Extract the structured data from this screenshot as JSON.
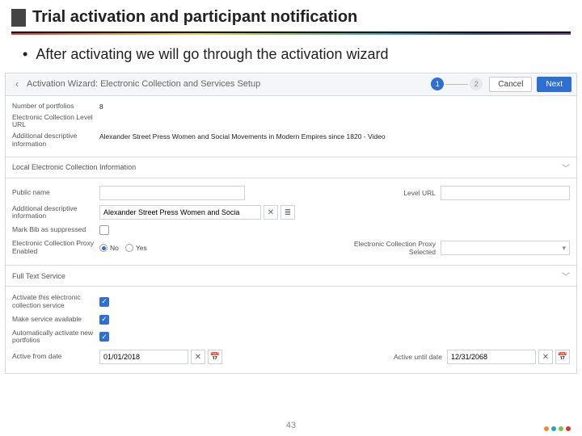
{
  "slide": {
    "title": "Trial activation and participant notification",
    "bullet": "After activating we will go through the activation wizard",
    "page_number": "43"
  },
  "wizard": {
    "back_glyph": "‹",
    "title": "Activation Wizard: Electronic Collection and Services Setup",
    "step_current": "1",
    "step_next": "2",
    "cancel": "Cancel",
    "next": "Next"
  },
  "summary": {
    "num_portfolios_label": "Number of portfolios",
    "num_portfolios_value": "8",
    "ec_url_label": "Electronic Collection Level URL",
    "ec_url_value": "",
    "addl_label": "Additional descriptive information",
    "addl_value": "Alexander Street Press Women and Social Movements in Modern Empires since 1820 - Video"
  },
  "sections": {
    "local_info": "Local Electronic Collection Information",
    "full_text": "Full Text Service"
  },
  "local": {
    "public_name_label": "Public name",
    "public_name_value": "",
    "level_url_label": "Level URL",
    "level_url_value": "",
    "addl_label": "Additional descriptive information",
    "addl_value": "Alexander Street Press Women and Socia",
    "mark_bib_label": "Mark Bib as suppressed",
    "proxy_enabled_label": "Electronic Collection Proxy Enabled",
    "proxy_no": "No",
    "proxy_yes": "Yes",
    "proxy_selected_label": "Electronic Collection Proxy Selected"
  },
  "fulltext": {
    "activate_label": "Activate this electronic collection service",
    "available_label": "Make service available",
    "auto_label": "Automatically activate new portfolios",
    "from_label": "Active from date",
    "from_value": "01/01/2018",
    "until_label": "Active until date",
    "until_value": "12/31/2068"
  },
  "icons": {
    "clear": "✕",
    "list": "≣",
    "calendar": "📅",
    "chevron_down": "﹀",
    "dropdown": "▾",
    "check": "✓"
  }
}
